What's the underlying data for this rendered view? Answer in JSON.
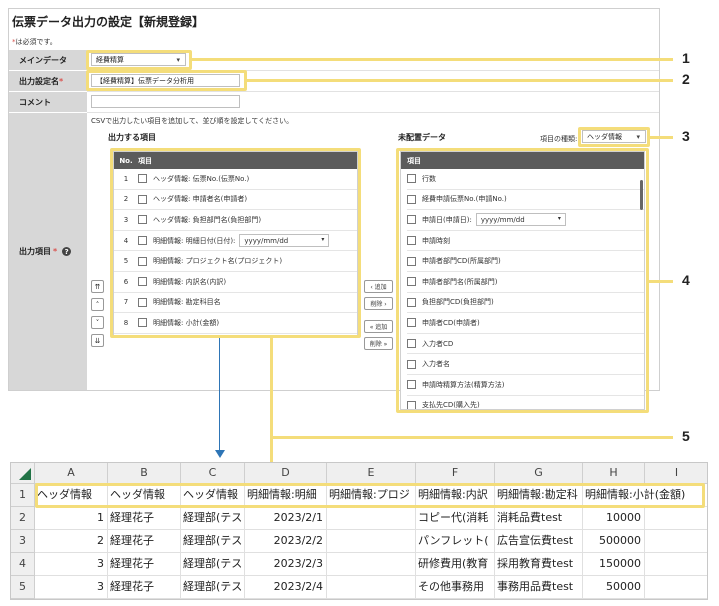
{
  "page": {
    "title": "伝票データ出力の設定【新規登録】",
    "required_note": "は必須です。",
    "required_mark": "*"
  },
  "form": {
    "main_data": {
      "label": "メインデータ",
      "value": "経費精算"
    },
    "output_name": {
      "label": "出力設定名",
      "value": "【経費精算】伝票データ分析用"
    },
    "comment": {
      "label": "コメント",
      "value": ""
    },
    "output_items": {
      "label": "出力項目",
      "help_icon": "question-circle-icon"
    },
    "instruction": "CSVで出力したい項目を追加して、並び順を設定してください。"
  },
  "output_list": {
    "title": "出力する項目",
    "col_no": "No.",
    "col_item": "項目",
    "rows": [
      {
        "no": "1",
        "label": "ヘッダ情報: 伝票No.(伝票No.)"
      },
      {
        "no": "2",
        "label": "ヘッダ情報: 申請者名(申請者)"
      },
      {
        "no": "3",
        "label": "ヘッダ情報: 負担部門名(負担部門)"
      },
      {
        "no": "4",
        "label": "明細情報: 明細日付(日付):",
        "select": "yyyy/mm/dd"
      },
      {
        "no": "5",
        "label": "明細情報: プロジェクト名(プロジェクト)"
      },
      {
        "no": "6",
        "label": "明細情報: 内訳名(内訳)"
      },
      {
        "no": "7",
        "label": "明細情報: 勘定科目名"
      },
      {
        "no": "8",
        "label": "明細情報: 小計(金額)"
      }
    ]
  },
  "order_buttons": [
    "⇈",
    "˄",
    "˅",
    "⇊"
  ],
  "move_buttons": [
    "‹ 追加",
    "削除 ›",
    "« 追加",
    "削除 »"
  ],
  "unassigned": {
    "title": "未配置データ",
    "type_label": "項目の種類:",
    "type_value": "ヘッダ情報",
    "col_item": "項目",
    "rows": [
      {
        "label": "行数"
      },
      {
        "label": "経費申請伝票No.(申請No.)"
      },
      {
        "label": "申請日(申請日):",
        "select": "yyyy/mm/dd"
      },
      {
        "label": "申請時刻"
      },
      {
        "label": "申請者部門CD(所属部門)"
      },
      {
        "label": "申請者部門名(所属部門)"
      },
      {
        "label": "負担部門CD(負担部門)"
      },
      {
        "label": "申請者CD(申請者)"
      },
      {
        "label": "入力者CD"
      },
      {
        "label": "入力者名"
      },
      {
        "label": "申請時精算方法(精算方法)"
      },
      {
        "label": "支払先CD(購入先)"
      }
    ]
  },
  "callouts": [
    "1",
    "2",
    "3",
    "4",
    "5"
  ],
  "spreadsheet": {
    "columns": [
      "A",
      "B",
      "C",
      "D",
      "E",
      "F",
      "G",
      "H",
      "I"
    ],
    "rows": [
      {
        "num": "1",
        "cells": [
          "ヘッダ情報",
          "ヘッダ情報",
          "ヘッダ情報",
          "明細情報:明細",
          "明細情報:プロジ",
          "明細情報:内訳",
          "明細情報:勘定科",
          "明細情報:小計(金額)",
          ""
        ]
      },
      {
        "num": "2",
        "cells": [
          "1",
          "経理花子",
          "経理部(テス",
          "2023/2/1",
          "",
          "コピー代(消耗",
          "消耗品費test",
          "10000",
          ""
        ]
      },
      {
        "num": "3",
        "cells": [
          "2",
          "経理花子",
          "経理部(テス",
          "2023/2/2",
          "",
          "パンフレット(",
          "広告宣伝費test",
          "500000",
          ""
        ]
      },
      {
        "num": "4",
        "cells": [
          "3",
          "経理花子",
          "経理部(テス",
          "2023/2/3",
          "",
          "研修費用(教育",
          "採用教育費test",
          "150000",
          ""
        ]
      },
      {
        "num": "5",
        "cells": [
          "3",
          "経理花子",
          "経理部(テス",
          "2023/2/4",
          "",
          "その他事務用",
          "事務用品費test",
          "50000",
          ""
        ]
      }
    ]
  },
  "colors": {
    "highlight": "#f4dd7a",
    "list_header": "#5b5b5b",
    "label_bg": "#d7d7d7",
    "required": "#d9534f",
    "arrow": "#2e75b6",
    "excel_corner": "#217346"
  }
}
